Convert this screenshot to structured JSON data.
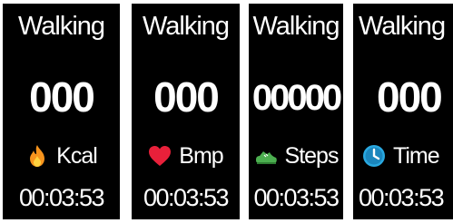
{
  "screens": [
    {
      "title": "Walking",
      "count": "000",
      "unit": "Kcal",
      "icon": "fire-icon",
      "timer": "00:03:53"
    },
    {
      "title": "Walking",
      "count": "000",
      "unit": "Bmp",
      "icon": "heart-icon",
      "timer": "00:03:53"
    },
    {
      "title": "Walking",
      "count": "00000",
      "unit": "Steps",
      "icon": "sneaker-icon",
      "timer": "00:03:53"
    },
    {
      "title": "Walking",
      "count": "000",
      "unit": "Time",
      "icon": "clock-icon",
      "timer": "00:03:53"
    }
  ],
  "colors": {
    "screen_background": "#000000",
    "text": "#ffffff",
    "fire": "#f7941d",
    "heart": "#e8203a",
    "sneaker": "#4caf50",
    "clock": "#29a8e0"
  }
}
